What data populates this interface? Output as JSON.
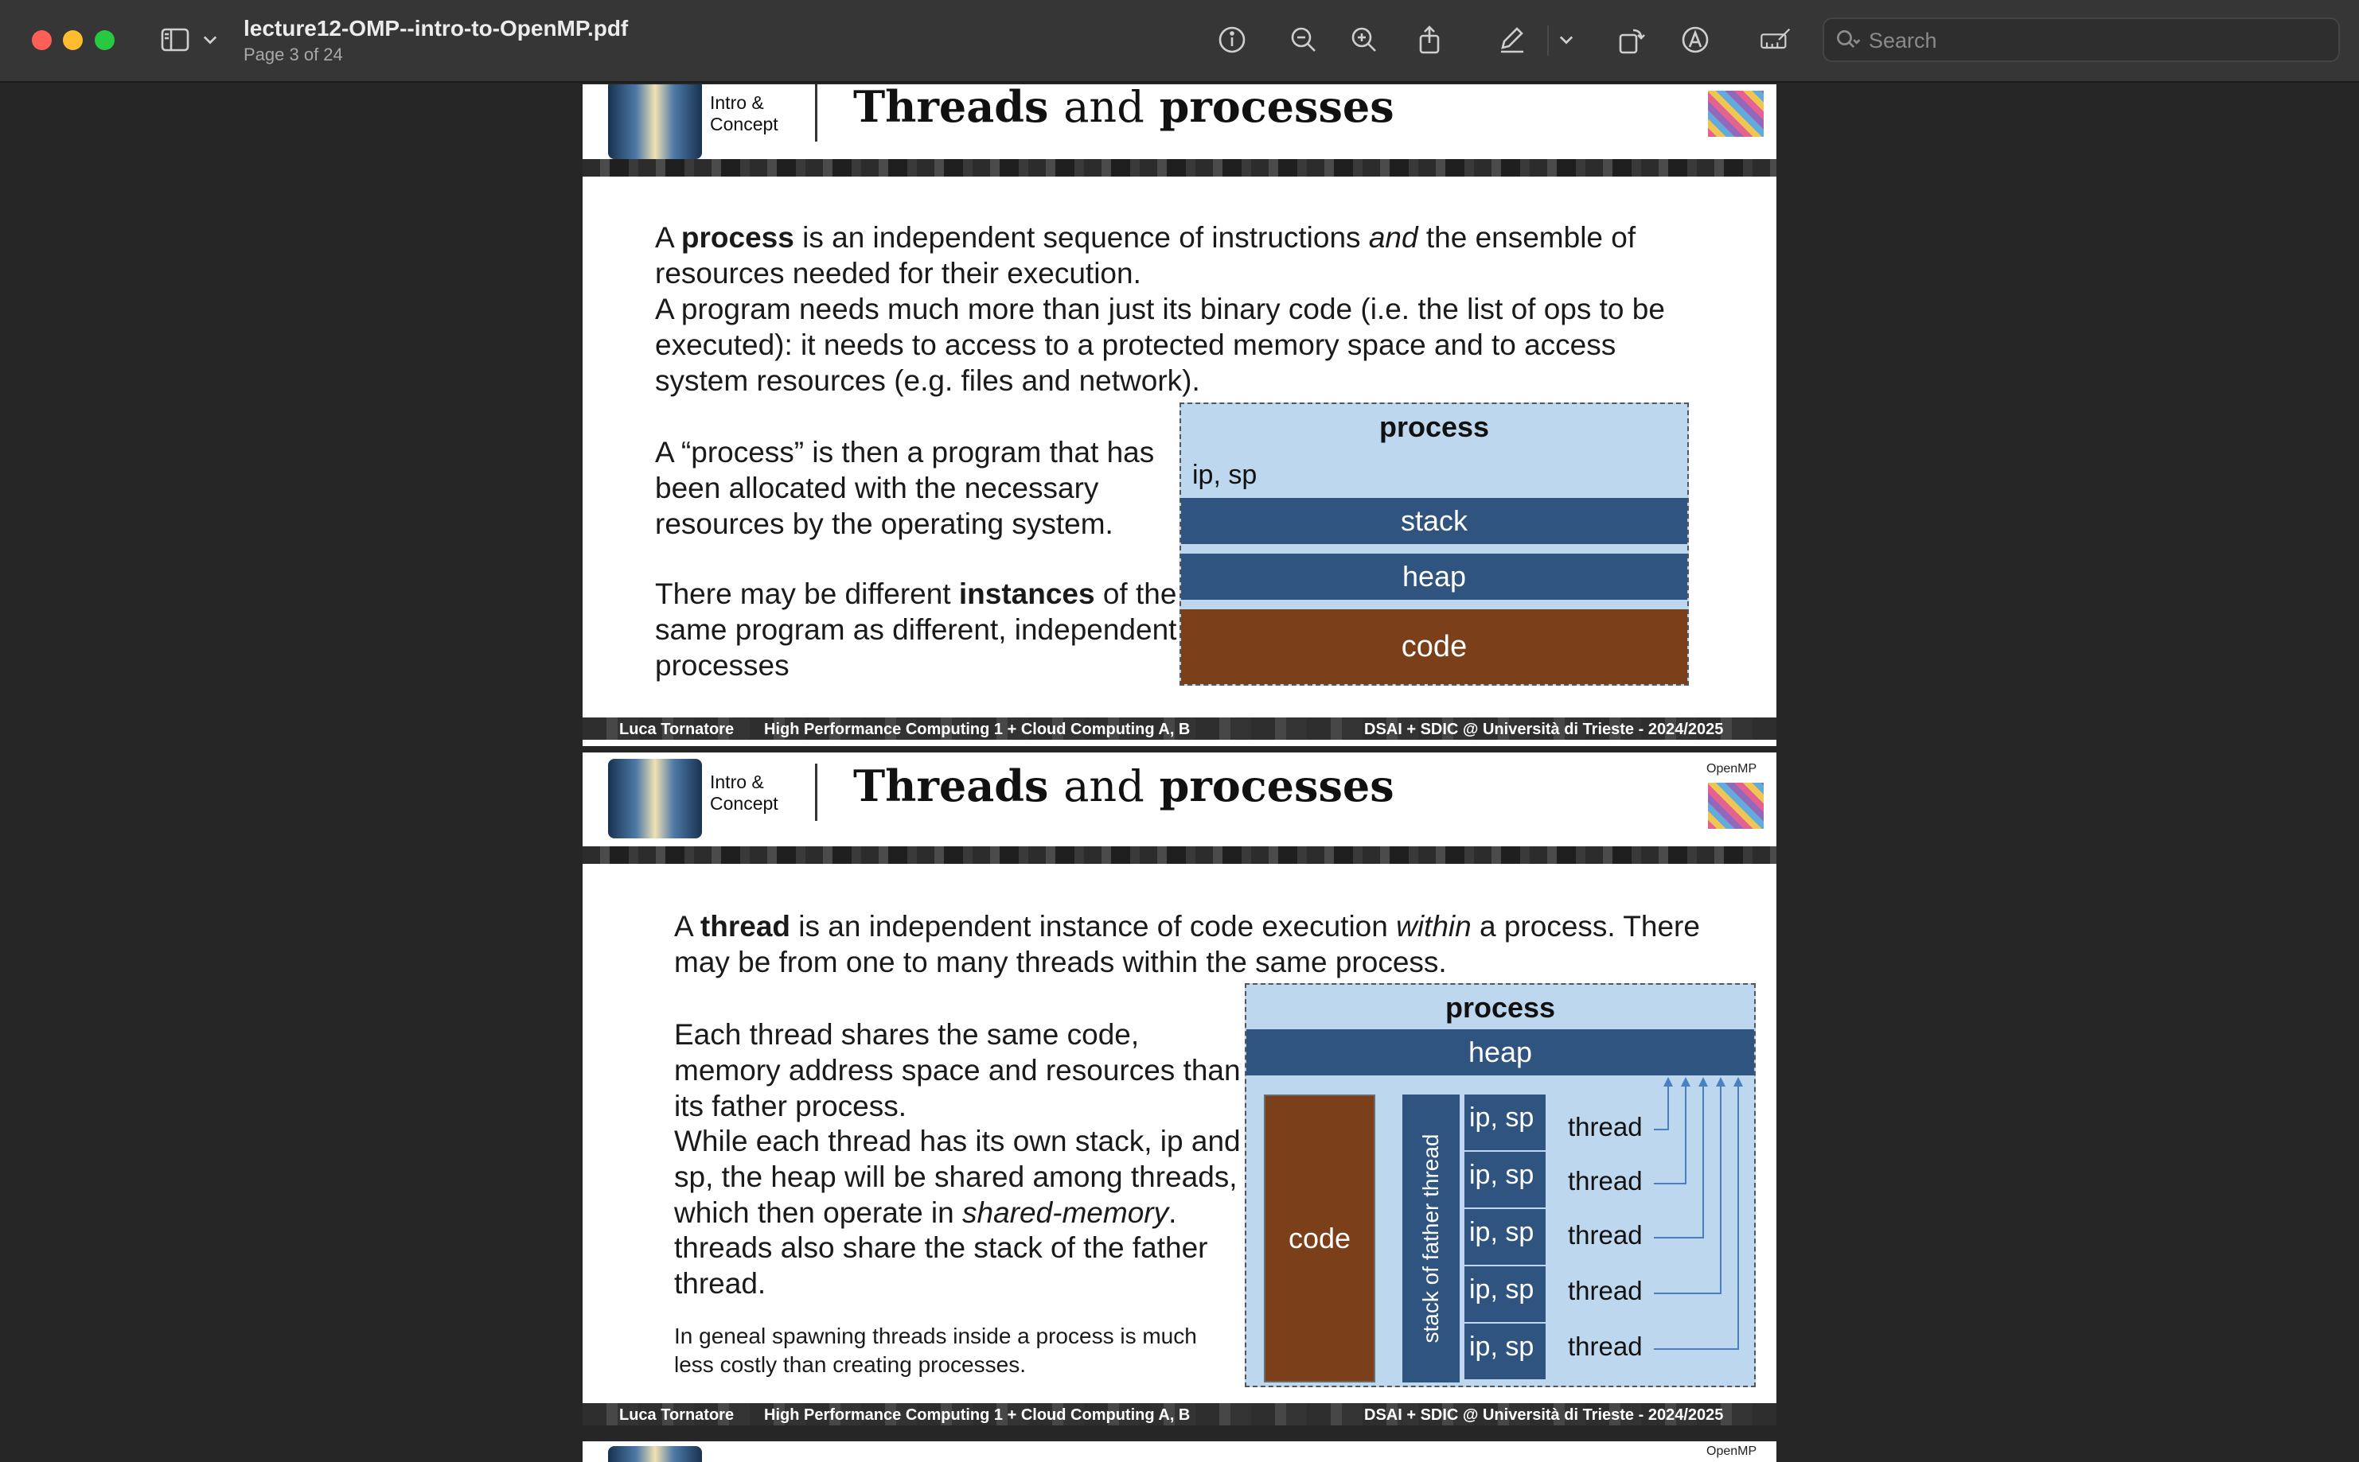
{
  "window": {
    "doc_title": "lecture12-OMP--intro-to-OpenMP.pdf",
    "page_indicator": "Page 3 of 24",
    "search_placeholder": "Search"
  },
  "toolbar_icons": [
    "sidebar-icon",
    "chevron-down-icon",
    "info-icon",
    "zoom-out-icon",
    "zoom-in-icon",
    "share-icon",
    "highlight-pen-icon",
    "chevron-down-icon",
    "rotate-icon",
    "markup-icon",
    "annotate-icon",
    "search-icon"
  ],
  "common": {
    "header_tag_line1": "Intro &",
    "header_tag_line2": "Concept",
    "openmp_label": "OpenMP",
    "footer_left": "Luca Tornatore",
    "footer_course": "High Performance Computing 1  + Cloud Computing A, B",
    "footer_right": "DSAI + SDIC @ Università di Trieste   - 2024/2025"
  },
  "slide1": {
    "title_a": "Threads",
    "title_b": "and",
    "title_c": "processes",
    "p1_pre": "A ",
    "p1_bold": "process",
    "p1_mid": " is an independent sequence of instructions ",
    "p1_ital": "and",
    "p1_post": " the ensemble of resources needed for their execution.",
    "p2": "A program needs much more than just its binary code (i.e. the list of ops to be executed): it needs to access to a protected memory space and to access system resources (e.g. files and network).",
    "p3": "A “process” is then a program that has been allocated with the necessary resources by the operating system.",
    "p4_pre": "There may be different ",
    "p4_bold": "instances",
    "p4_post": " of the same program as different, independent processes",
    "diagram": {
      "title": "process",
      "registers": "ip, sp",
      "stack": "stack",
      "heap": "heap",
      "code": "code"
    }
  },
  "slide2": {
    "title_a": "Threads",
    "title_b": "and",
    "title_c": "processes",
    "p1_pre": "A ",
    "p1_bold": "thread",
    "p1_mid": " is an independent instance of code execution ",
    "p1_ital": "within",
    "p1_post": " a process. There may be from one to many threads within the same process.",
    "p2": "Each thread shares the same code, memory address space and resources than its father process.",
    "p3_pre": "While each thread has its own stack, ip and sp, the heap will be shared among threads, which then operate in ",
    "p3_ital": "shared-memory",
    "p3_post": ".",
    "p4": "threads also share the stack of the father thread.",
    "note": "In geneal spawning threads inside a process is much less costly than creating processes.",
    "diagram": {
      "title": "process",
      "heap": "heap",
      "code": "code",
      "father_stack": "stack of father thread",
      "ipsp": [
        "ip, sp",
        "ip, sp",
        "ip, sp",
        "ip, sp",
        "ip, sp"
      ],
      "threads": [
        "thread",
        "thread",
        "thread",
        "thread",
        "thread"
      ]
    }
  }
}
